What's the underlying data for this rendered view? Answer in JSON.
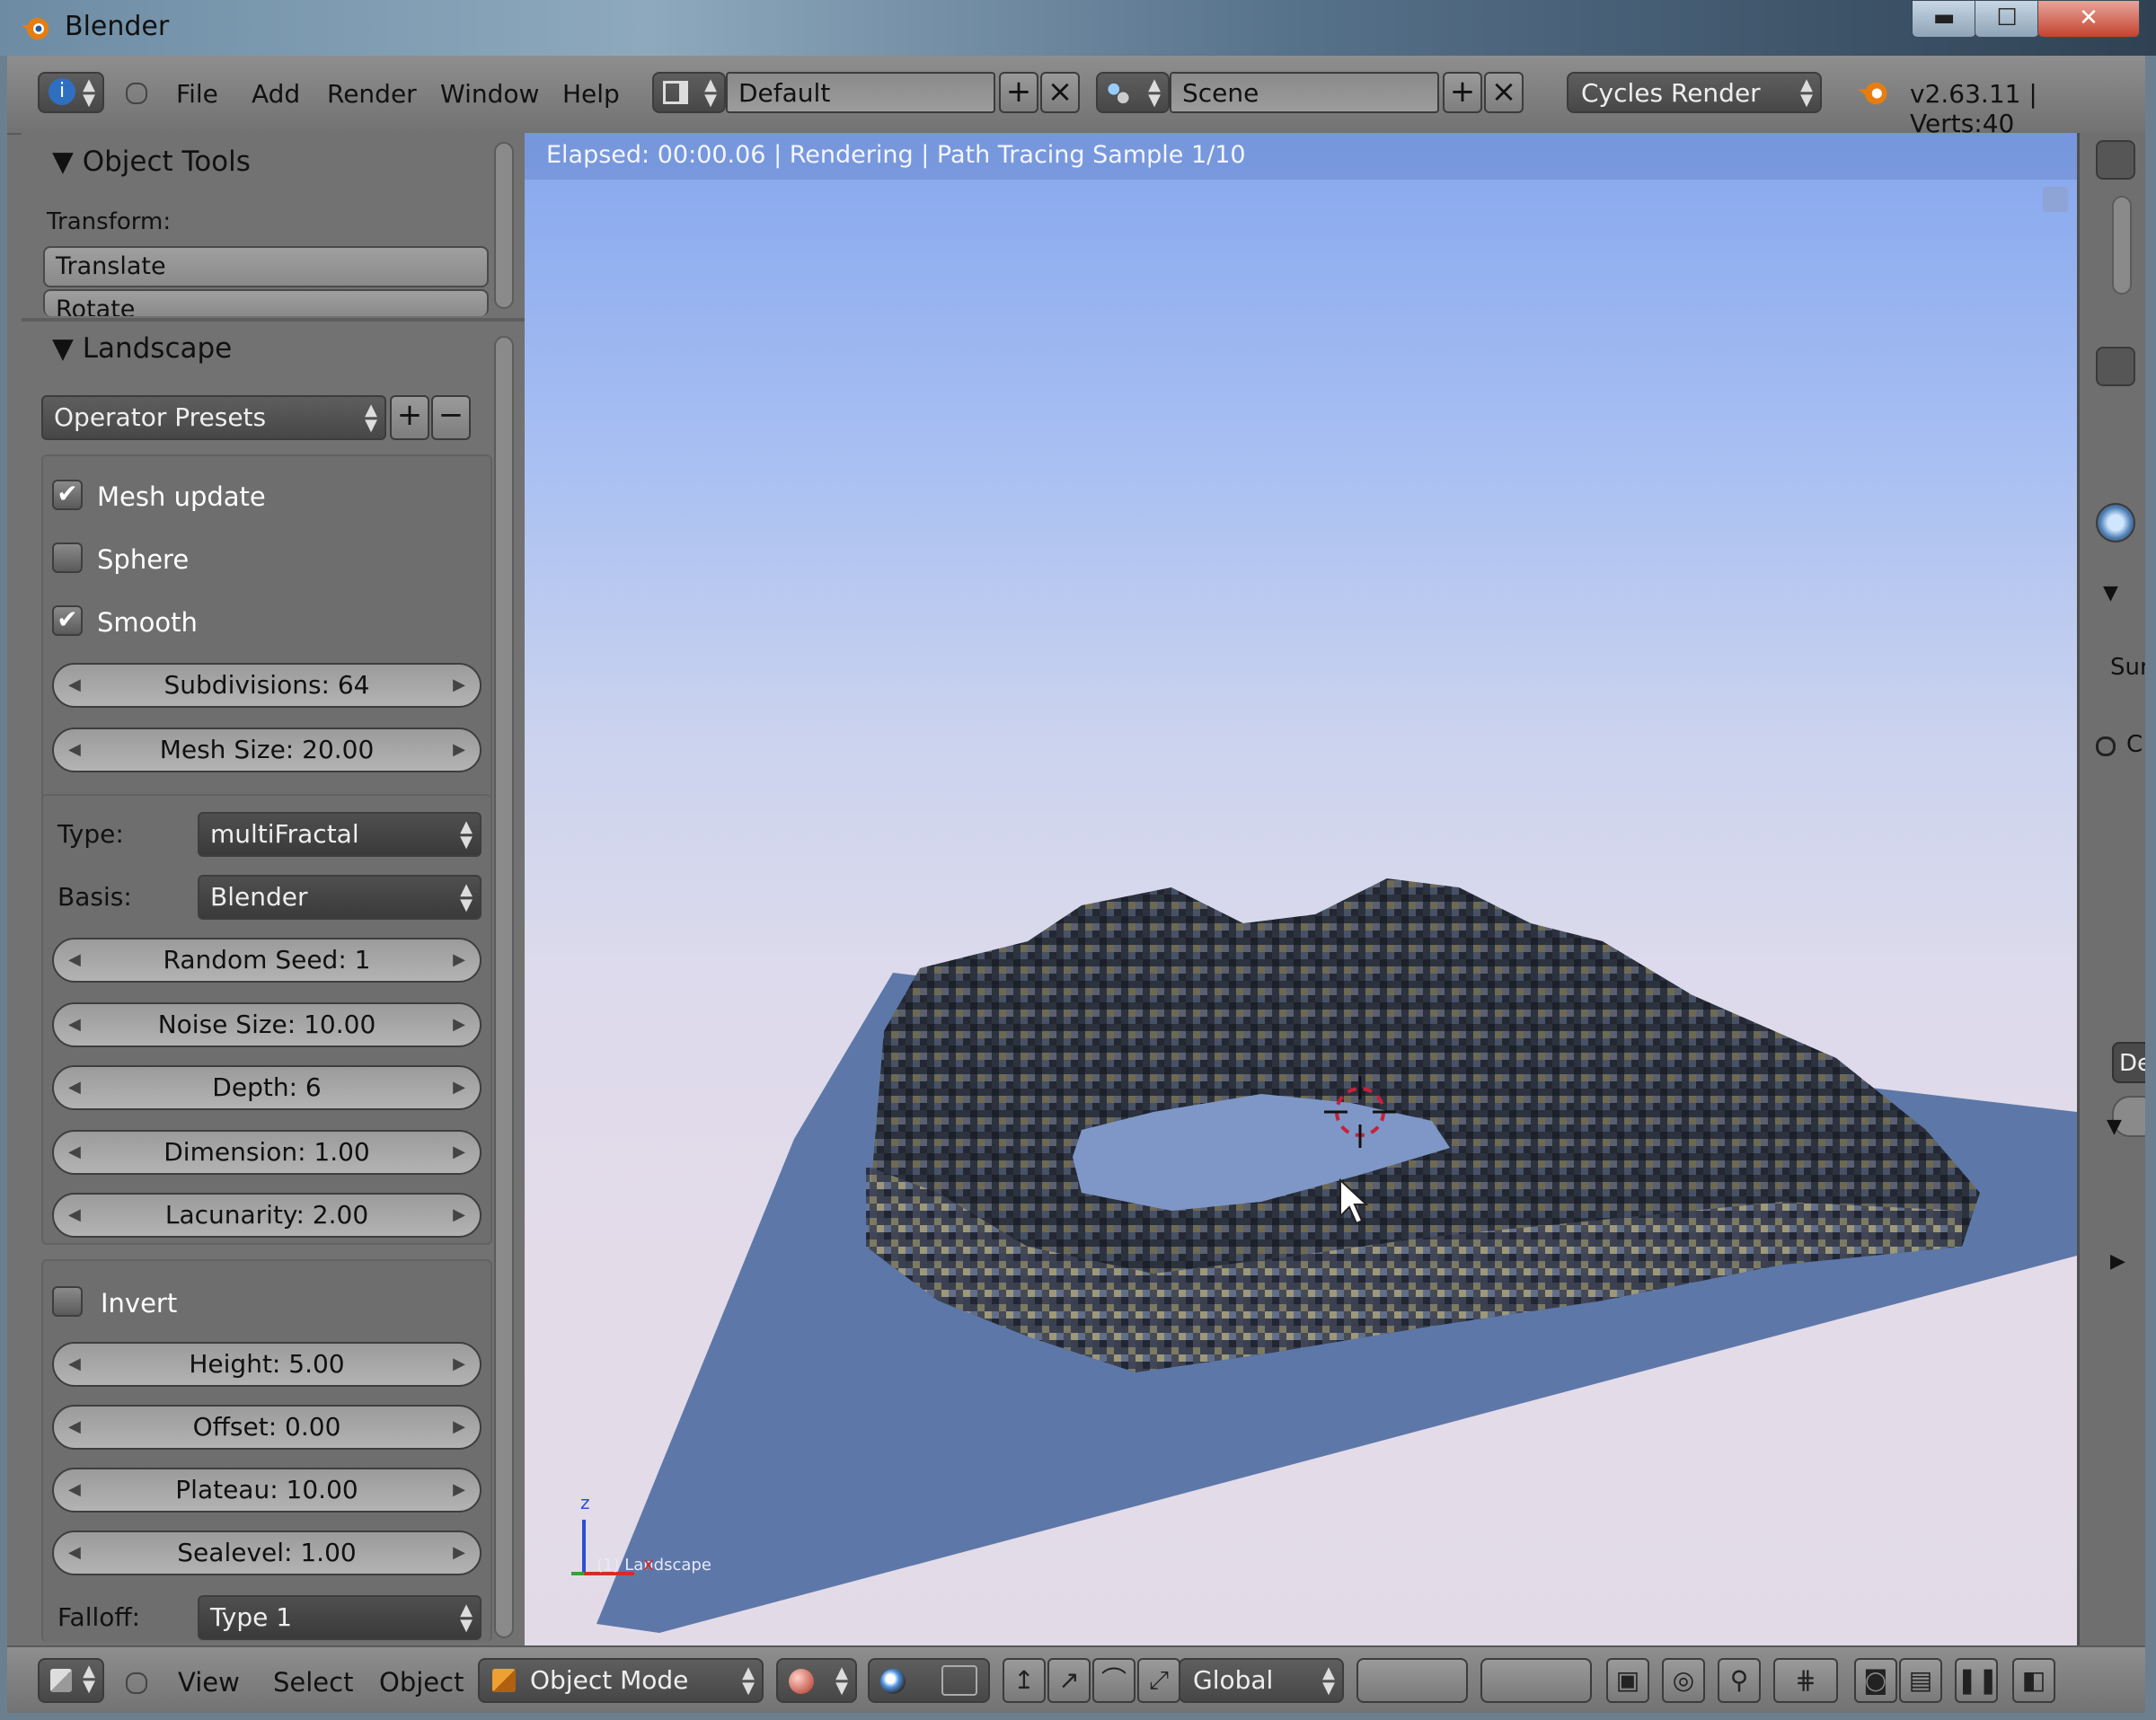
{
  "window": {
    "title": "Blender",
    "minimize": "▬",
    "maximize": "☐",
    "close": "✕"
  },
  "topbar": {
    "menus": [
      "File",
      "Add",
      "Render",
      "Window",
      "Help"
    ],
    "layout": "Default",
    "scene": "Scene",
    "engine": "Cycles Render",
    "stats": "v2.63.11 | Verts:40"
  },
  "toolshelf": {
    "object_tools": {
      "title": "Object Tools",
      "transform_label": "Transform:",
      "buttons": [
        "Translate",
        "Rotate"
      ]
    },
    "landscape": {
      "title": "Landscape",
      "presets": "Operator Presets",
      "checks": [
        {
          "label": "Mesh update",
          "checked": true
        },
        {
          "label": "Sphere",
          "checked": false
        },
        {
          "label": "Smooth",
          "checked": true
        }
      ],
      "mesh_fields": [
        "Subdivisions: 64",
        "Mesh Size: 20.00"
      ],
      "type_label": "Type:",
      "type_value": "multiFractal",
      "basis_label": "Basis:",
      "basis_value": "Blender",
      "noise_fields": [
        "Random Seed: 1",
        "Noise Size: 10.00",
        "Depth: 6",
        "Dimension: 1.00",
        "Lacunarity: 2.00"
      ],
      "invert_label": "Invert",
      "invert_checked": false,
      "height_fields": [
        "Height: 5.00",
        "Offset: 0.00",
        "Plateau: 10.00",
        "Sealevel: 1.00"
      ],
      "falloff_label": "Falloff:",
      "falloff_value": "Type 1"
    }
  },
  "viewport": {
    "status": "Elapsed: 00:00.06 | Rendering | Path Tracing Sample 1/10",
    "object_name": "(1) Landscape",
    "axis_z": "z",
    "axis_x": "x"
  },
  "rightpanel": {
    "label_sur": "Sur",
    "label_c": "C",
    "label_de": "De"
  },
  "bottombar": {
    "menus": [
      "View",
      "Select",
      "Object"
    ],
    "mode": "Object Mode",
    "orientation": "Global"
  },
  "colors": {
    "sky_top": "#86a7ee",
    "ground": "#e2dbe7",
    "plane": "#5d78a8",
    "terrain": "#2b313d",
    "ui_gray": "#727272"
  }
}
